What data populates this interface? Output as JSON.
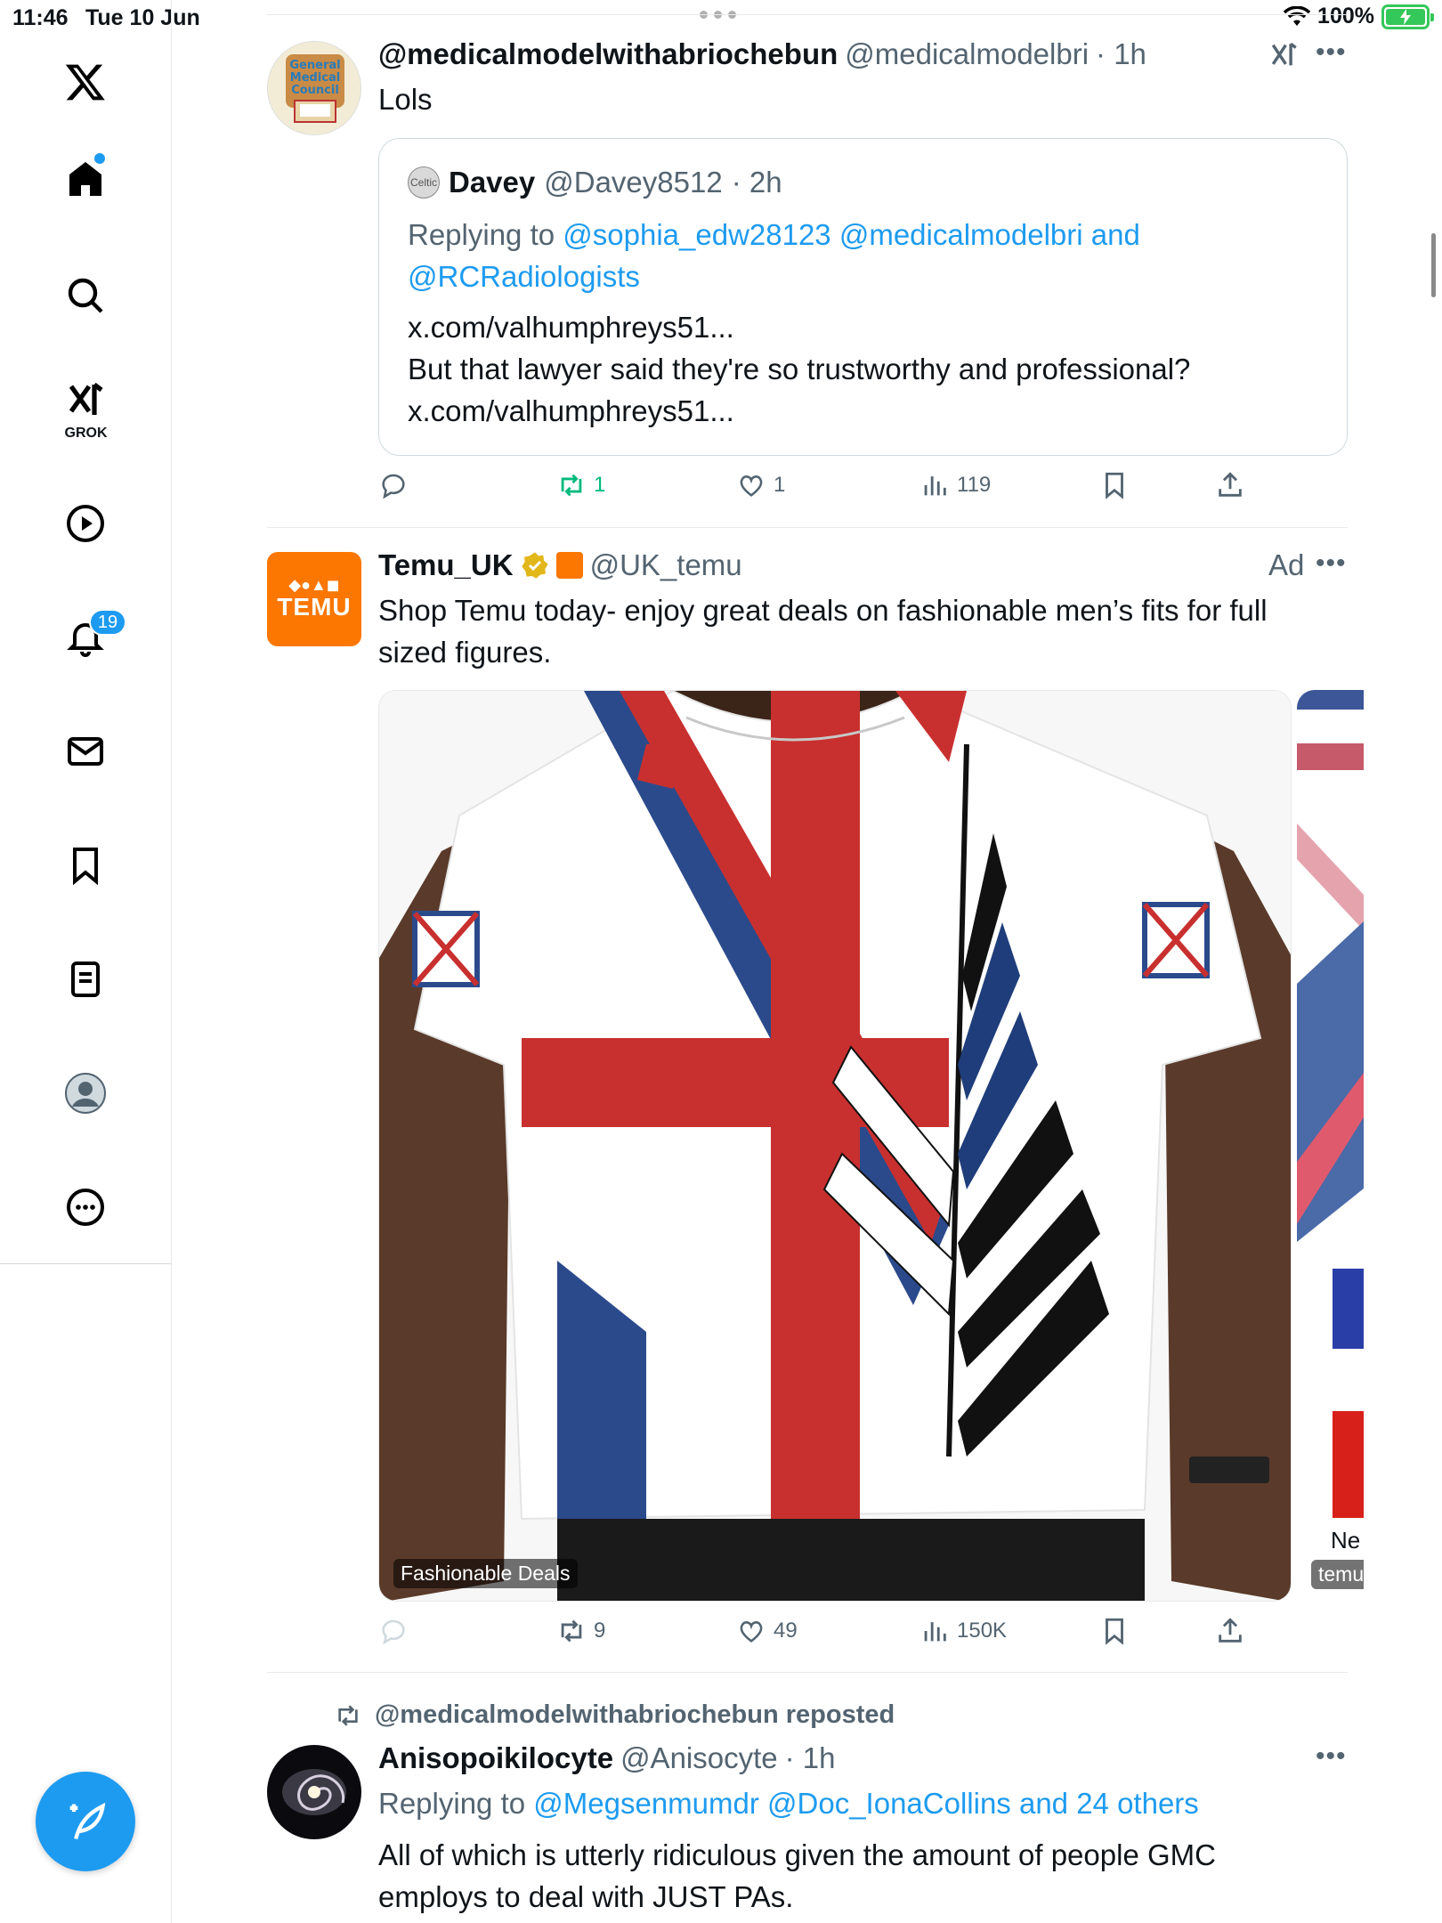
{
  "status_bar": {
    "time": "11:46",
    "date": "Tue 10 Jun",
    "battery": "100%"
  },
  "sidebar": {
    "grok_label": "GROK",
    "notifications_count": "19"
  },
  "tweet1": {
    "display_name": "@medicalmodelwithabriochebun",
    "handle": "@medicalmodelbri",
    "time": "· 1h",
    "text": "Lols",
    "avatar_text": [
      "General",
      "Medical",
      "Council"
    ],
    "quote": {
      "name": "Davey",
      "handle": "@Davey8512",
      "time": "· 2h",
      "avatar_text": "Celtic",
      "replying_label": "Replying to ",
      "replying_to": "@sophia_edw28123 @medicalmodelbri and @RCRadiologists",
      "line1": "x.com/valhumphreys51...",
      "line2": "But that lawyer said they're so trustworthy and professional?",
      "line3": "x.com/valhumphreys51..."
    },
    "actions": {
      "retweets": "1",
      "likes": "1",
      "views": "119"
    }
  },
  "tweet2": {
    "display_name": "Temu_UK",
    "handle": "@UK_temu",
    "ad_label": "Ad",
    "logo_text": "TEMU",
    "text": "Shop Temu today- enjoy great deals on fashionable men’s fits for full sized figures.",
    "media_label": "Fashionable Deals",
    "media2_text": "Ne",
    "media2_label": "temu",
    "actions": {
      "retweets": "9",
      "likes": "49",
      "views": "150K"
    }
  },
  "tweet3": {
    "repost_label": "@medicalmodelwithabriochebun reposted",
    "display_name": "Anisopoikilocyte",
    "handle": "@Anisocyte",
    "time": "· 1h",
    "replying_label": "Replying to ",
    "replying_to": "@Megsenmumdr @Doc_IonaCollins and 24 others",
    "text": "All of which is utterly ridiculous given the amount of people GMC employs to deal with JUST PAs."
  },
  "colors": {
    "accent": "#1d9bf0",
    "muted": "#536471",
    "retweet_green": "#00ba7c",
    "temu_orange": "#fb7701"
  }
}
